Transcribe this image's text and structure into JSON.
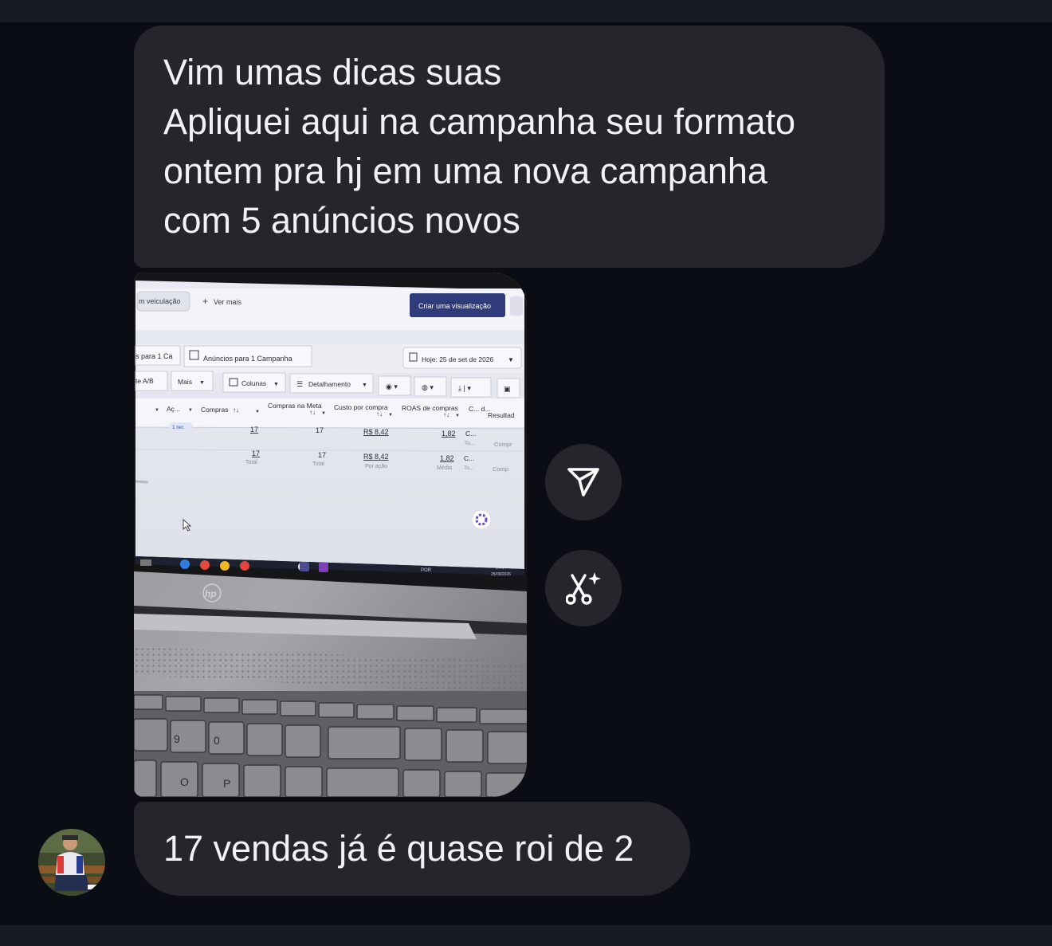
{
  "messages": {
    "first": {
      "lines": [
        "Vim umas dicas suas",
        "Apliquei aqui na campanha seu formato",
        "ontem pra hj em uma nova campanha",
        "com 5 anúncios novos"
      ]
    },
    "photo": {
      "nav": {
        "tab_active": "m veiculação",
        "ver_mais": "Ver mais",
        "create_button": "Criar uma visualização"
      },
      "tabs": {
        "tab1": "s para 1 Ca",
        "tab2": "Anúncios para 1 Campanha",
        "date": "Hoje: 25 de set de 2026"
      },
      "toolbar": {
        "ab": "te A/B",
        "mais": "Mais",
        "colunas": "Colunas",
        "detalhamento": "Detalhamento"
      },
      "table": {
        "headers": [
          "Aç...",
          "Compras",
          "Compras na Meta",
          "Custo por compra",
          "ROAS de compras",
          "C... d...",
          "Resultad"
        ],
        "row1": {
          "badge": "1 rec",
          "compras": "17",
          "meta": "17",
          "custo": "R$ 8,42",
          "roas": "1,82",
          "c": "C...",
          "c_sub": "To...",
          "result": "Compr"
        },
        "row2": {
          "compras": "17",
          "compras_sub": "Total",
          "meta": "17",
          "meta_sub": "Total",
          "custo": "R$ 8,42",
          "custo_sub": "Por ação",
          "roas": "1,82",
          "roas_sub": "Média",
          "c": "C...",
          "c_sub": "To...",
          "result": "Comp"
        }
      },
      "taskbar": {
        "lang": "POR",
        "time": "14:14",
        "date": "25/09/2026"
      },
      "brand": "hp"
    },
    "second": {
      "text": "17 vendas já é quase roi de 2"
    }
  },
  "actions": {
    "share_icon": "paper-plane-icon",
    "magic_icon": "scissors-sparkle-icon"
  },
  "colors": {
    "background": "#0b0d14",
    "bubble": "#25262c",
    "text": "#f2f2f4",
    "accent_button": "#2f3b7a"
  }
}
